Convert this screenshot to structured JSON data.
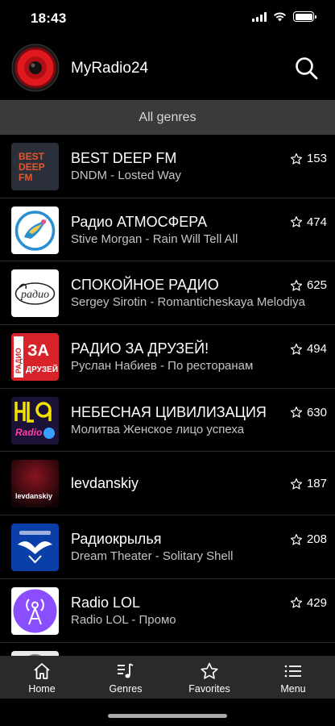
{
  "status_bar": {
    "time": "18:43"
  },
  "header": {
    "title": "MyRadio24"
  },
  "genre_filter": {
    "label": "All genres"
  },
  "stations": [
    {
      "name": "BEST DEEP FM",
      "track": "DNDM - Losted Way",
      "favorites": "153",
      "logo": "best-deep-fm-logo"
    },
    {
      "name": "Радио АТМОСФЕРА",
      "track": "Stive Morgan - Rain Will Tell All",
      "favorites": "474",
      "logo": "radio-atmosfera-logo"
    },
    {
      "name": "СПОКОЙНОЕ РАДИО",
      "track": "Sergey Sirotin - Romanticheskaya Melodiya",
      "favorites": "625",
      "logo": "spokoinoe-radio-logo"
    },
    {
      "name": "РАДИО ЗА ДРУЗЕЙ!",
      "track": "Руслан Набиев - По ресторанам",
      "favorites": "494",
      "logo": "radio-za-druzei-logo"
    },
    {
      "name": "НЕБЕСНАЯ ЦИВИЛИЗАЦИЯ",
      "track": "Молитва Женское лицо успеха",
      "favorites": "630",
      "logo": "nebesnaya-civilizaciya-logo"
    },
    {
      "name": "levdanskiy",
      "track": "",
      "favorites": "187",
      "logo": "levdanskiy-logo"
    },
    {
      "name": "Радиокрылья",
      "track": "Dream Theater - Solitary Shell",
      "favorites": "208",
      "logo": "radiokrylya-logo"
    },
    {
      "name": "Radio LOL",
      "track": "Radio LOL - Промо",
      "favorites": "429",
      "logo": "radio-lol-logo"
    }
  ],
  "logo_text": {
    "best_deep_fm": [
      "BEST",
      "DEEP",
      "FM"
    ],
    "spokoinoe": "радио",
    "za_druzei": [
      "ЗА",
      "ДРУЗЕЙ"
    ],
    "za_druzei_side": "РАДИО",
    "hlq": "Radio",
    "levdanskiy": "levdanskiy"
  },
  "tabs": [
    {
      "label": "Home",
      "icon": "home-icon"
    },
    {
      "label": "Genres",
      "icon": "music-notes-icon"
    },
    {
      "label": "Favorites",
      "icon": "star-icon"
    },
    {
      "label": "Menu",
      "icon": "menu-list-icon"
    }
  ],
  "colors": {
    "background": "#000000",
    "genre_bar": "#3a3a3c",
    "tab_bar": "#2a2a2c",
    "accent_red": "#e0191f"
  }
}
